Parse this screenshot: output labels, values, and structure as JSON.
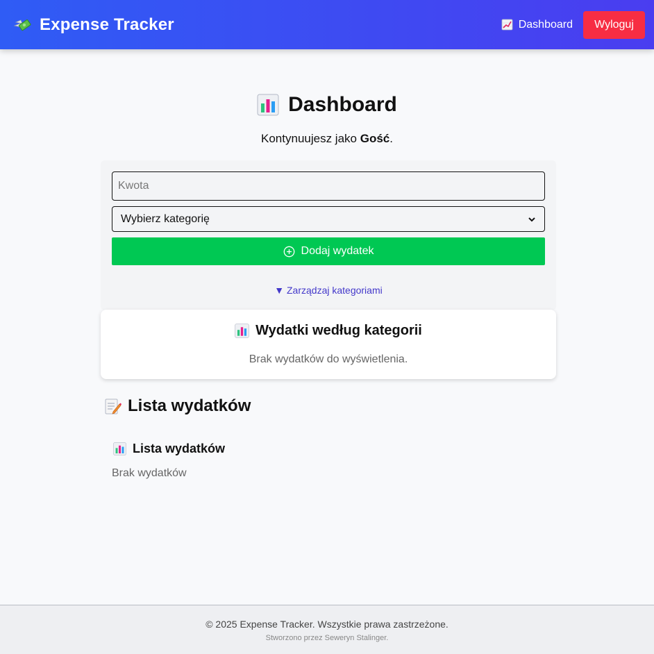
{
  "navbar": {
    "brand": "Expense Tracker",
    "dashboard_link": "Dashboard",
    "logout_label": "Wyloguj",
    "icons": {
      "brand": "money-with-wings-icon",
      "dashboard": "chart-increasing-icon"
    }
  },
  "page": {
    "title": "Dashboard",
    "welcome_prefix": "Kontynuujesz jako ",
    "user_name": "Gość",
    "welcome_suffix": "."
  },
  "form": {
    "amount_placeholder": "Kwota",
    "category_selected": "Wybierz kategorię",
    "add_button_label": "Dodaj wydatek",
    "manage_categories_label": "▼ Zarządzaj kategoriami"
  },
  "chart_section": {
    "title": "Wydatki według kategorii",
    "empty_message": "Brak wydatków do wyświetlenia."
  },
  "list_section": {
    "heading": "Lista wydatków",
    "subheading": "Lista wydatków",
    "empty_message": "Brak wydatków"
  },
  "footer": {
    "copyright": "© 2025 Expense Tracker. Wszystkie prawa zastrzeżone.",
    "credit": "Stworzono przez Seweryn Stalinger."
  },
  "colors": {
    "nav_gradient_start": "#2f5cf5",
    "nav_gradient_end": "#4a3df0",
    "logout": "#f72d43",
    "add_button": "#00c853",
    "link": "#4338ca"
  }
}
